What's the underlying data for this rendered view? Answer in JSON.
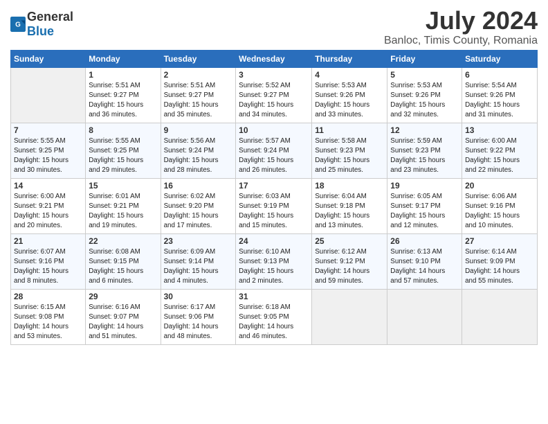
{
  "header": {
    "logo_general": "General",
    "logo_blue": "Blue",
    "month_year": "July 2024",
    "location": "Banloc, Timis County, Romania"
  },
  "weekdays": [
    "Sunday",
    "Monday",
    "Tuesday",
    "Wednesday",
    "Thursday",
    "Friday",
    "Saturday"
  ],
  "weeks": [
    [
      {
        "day": "",
        "info": ""
      },
      {
        "day": "1",
        "info": "Sunrise: 5:51 AM\nSunset: 9:27 PM\nDaylight: 15 hours\nand 36 minutes."
      },
      {
        "day": "2",
        "info": "Sunrise: 5:51 AM\nSunset: 9:27 PM\nDaylight: 15 hours\nand 35 minutes."
      },
      {
        "day": "3",
        "info": "Sunrise: 5:52 AM\nSunset: 9:27 PM\nDaylight: 15 hours\nand 34 minutes."
      },
      {
        "day": "4",
        "info": "Sunrise: 5:53 AM\nSunset: 9:26 PM\nDaylight: 15 hours\nand 33 minutes."
      },
      {
        "day": "5",
        "info": "Sunrise: 5:53 AM\nSunset: 9:26 PM\nDaylight: 15 hours\nand 32 minutes."
      },
      {
        "day": "6",
        "info": "Sunrise: 5:54 AM\nSunset: 9:26 PM\nDaylight: 15 hours\nand 31 minutes."
      }
    ],
    [
      {
        "day": "7",
        "info": "Sunrise: 5:55 AM\nSunset: 9:25 PM\nDaylight: 15 hours\nand 30 minutes."
      },
      {
        "day": "8",
        "info": "Sunrise: 5:55 AM\nSunset: 9:25 PM\nDaylight: 15 hours\nand 29 minutes."
      },
      {
        "day": "9",
        "info": "Sunrise: 5:56 AM\nSunset: 9:24 PM\nDaylight: 15 hours\nand 28 minutes."
      },
      {
        "day": "10",
        "info": "Sunrise: 5:57 AM\nSunset: 9:24 PM\nDaylight: 15 hours\nand 26 minutes."
      },
      {
        "day": "11",
        "info": "Sunrise: 5:58 AM\nSunset: 9:23 PM\nDaylight: 15 hours\nand 25 minutes."
      },
      {
        "day": "12",
        "info": "Sunrise: 5:59 AM\nSunset: 9:23 PM\nDaylight: 15 hours\nand 23 minutes."
      },
      {
        "day": "13",
        "info": "Sunrise: 6:00 AM\nSunset: 9:22 PM\nDaylight: 15 hours\nand 22 minutes."
      }
    ],
    [
      {
        "day": "14",
        "info": "Sunrise: 6:00 AM\nSunset: 9:21 PM\nDaylight: 15 hours\nand 20 minutes."
      },
      {
        "day": "15",
        "info": "Sunrise: 6:01 AM\nSunset: 9:21 PM\nDaylight: 15 hours\nand 19 minutes."
      },
      {
        "day": "16",
        "info": "Sunrise: 6:02 AM\nSunset: 9:20 PM\nDaylight: 15 hours\nand 17 minutes."
      },
      {
        "day": "17",
        "info": "Sunrise: 6:03 AM\nSunset: 9:19 PM\nDaylight: 15 hours\nand 15 minutes."
      },
      {
        "day": "18",
        "info": "Sunrise: 6:04 AM\nSunset: 9:18 PM\nDaylight: 15 hours\nand 13 minutes."
      },
      {
        "day": "19",
        "info": "Sunrise: 6:05 AM\nSunset: 9:17 PM\nDaylight: 15 hours\nand 12 minutes."
      },
      {
        "day": "20",
        "info": "Sunrise: 6:06 AM\nSunset: 9:16 PM\nDaylight: 15 hours\nand 10 minutes."
      }
    ],
    [
      {
        "day": "21",
        "info": "Sunrise: 6:07 AM\nSunset: 9:16 PM\nDaylight: 15 hours\nand 8 minutes."
      },
      {
        "day": "22",
        "info": "Sunrise: 6:08 AM\nSunset: 9:15 PM\nDaylight: 15 hours\nand 6 minutes."
      },
      {
        "day": "23",
        "info": "Sunrise: 6:09 AM\nSunset: 9:14 PM\nDaylight: 15 hours\nand 4 minutes."
      },
      {
        "day": "24",
        "info": "Sunrise: 6:10 AM\nSunset: 9:13 PM\nDaylight: 15 hours\nand 2 minutes."
      },
      {
        "day": "25",
        "info": "Sunrise: 6:12 AM\nSunset: 9:12 PM\nDaylight: 14 hours\nand 59 minutes."
      },
      {
        "day": "26",
        "info": "Sunrise: 6:13 AM\nSunset: 9:10 PM\nDaylight: 14 hours\nand 57 minutes."
      },
      {
        "day": "27",
        "info": "Sunrise: 6:14 AM\nSunset: 9:09 PM\nDaylight: 14 hours\nand 55 minutes."
      }
    ],
    [
      {
        "day": "28",
        "info": "Sunrise: 6:15 AM\nSunset: 9:08 PM\nDaylight: 14 hours\nand 53 minutes."
      },
      {
        "day": "29",
        "info": "Sunrise: 6:16 AM\nSunset: 9:07 PM\nDaylight: 14 hours\nand 51 minutes."
      },
      {
        "day": "30",
        "info": "Sunrise: 6:17 AM\nSunset: 9:06 PM\nDaylight: 14 hours\nand 48 minutes."
      },
      {
        "day": "31",
        "info": "Sunrise: 6:18 AM\nSunset: 9:05 PM\nDaylight: 14 hours\nand 46 minutes."
      },
      {
        "day": "",
        "info": ""
      },
      {
        "day": "",
        "info": ""
      },
      {
        "day": "",
        "info": ""
      }
    ]
  ]
}
